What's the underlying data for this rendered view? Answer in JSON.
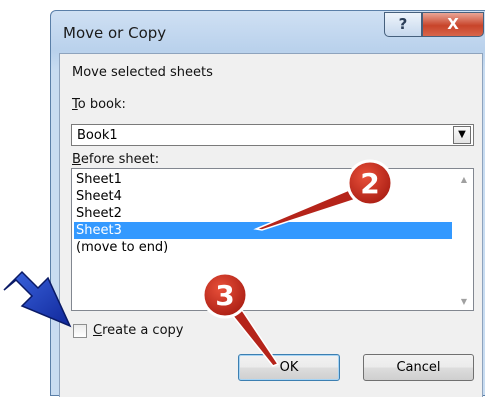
{
  "window": {
    "title": "Move or Copy"
  },
  "titlebar": {
    "help_label": "?",
    "close_label": "X"
  },
  "dialog": {
    "instruction": "Move selected sheets",
    "to_book_label": "To book:",
    "to_book_value": "Book1",
    "before_sheet_label": "Before sheet:",
    "sheets": [
      "Sheet1",
      "Sheet4",
      "Sheet2",
      "Sheet3",
      "(move to end)"
    ],
    "selected_sheet": "Sheet3",
    "create_copy_label": "Create a copy",
    "create_copy_checked": false
  },
  "buttons": {
    "ok_label": "OK",
    "cancel_label": "Cancel"
  },
  "annotations": {
    "marker_2": "2",
    "marker_3": "3"
  },
  "colors": {
    "selection": "#3399ff",
    "marker_red": "#c0281c",
    "arrow_blue": "#1f3fbf"
  }
}
